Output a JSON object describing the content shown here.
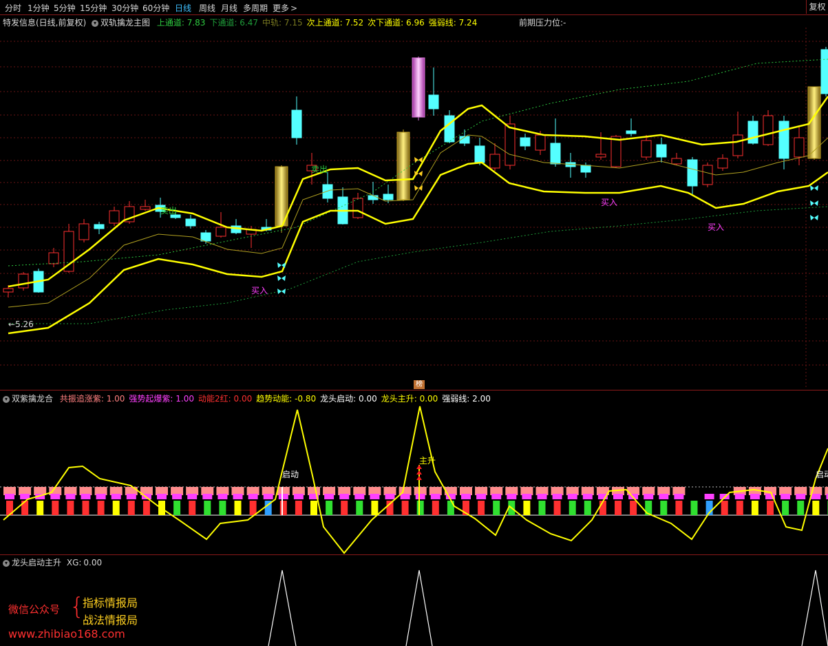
{
  "toolbar": {
    "periods": [
      "分时",
      "1分钟",
      "5分钟",
      "15分钟",
      "30分钟",
      "60分钟",
      "日线",
      "周线",
      "月线",
      "多周期",
      "更多"
    ],
    "active_period": "日线",
    "more_arrow": ">",
    "fuquan": "复权"
  },
  "main_panel": {
    "stock_label": "特发信息(日线,前复权)",
    "indicator_name": "双轨擒龙主图",
    "values": [
      {
        "label": "上通道:",
        "value": "7.83",
        "color": "#2ecc40"
      },
      {
        "label": "下通道:",
        "value": "6.47",
        "color": "#1f9e3a"
      },
      {
        "label": "中轨:",
        "value": "7.15",
        "color": "#7a7a20"
      },
      {
        "label": "次上通道:",
        "value": "7.52",
        "color": "#ffff00"
      },
      {
        "label": "次下通道:",
        "value": "6.96",
        "color": "#ffff00"
      },
      {
        "label": "强弱线:",
        "value": "7.24",
        "color": "#ffff00"
      }
    ],
    "pressure_label": "前期压力位:",
    "pressure_value": "-",
    "low_marker": "5.26",
    "signals": {
      "sell": "卖出",
      "buy": "买入"
    },
    "bottom_tag": "榜"
  },
  "sub_panel1": {
    "indicator_name": "双紫擒龙合",
    "values": [
      {
        "label": "共振追涨紫:",
        "value": "1.00",
        "color": "#ff8080"
      },
      {
        "label": "强势起爆紫:",
        "value": "1.00",
        "color": "#ff40ff"
      },
      {
        "label": "动能2红:",
        "value": "0.00",
        "color": "#ff3030"
      },
      {
        "label": "趋势动能:",
        "value": "-0.80",
        "color": "#ffff00"
      },
      {
        "label": "龙头启动:",
        "value": "0.00",
        "color": "#ffffff"
      },
      {
        "label": "龙头主升:",
        "value": "0.00",
        "color": "#ffff00"
      },
      {
        "label": "强弱线:",
        "value": "2.00",
        "color": "#ffffff"
      }
    ],
    "annotations": {
      "start": "启动",
      "main_rise": "主升"
    }
  },
  "sub_panel2": {
    "indicator_name": "龙头启动主升",
    "xg_label": "XG:",
    "xg_value": "0.00"
  },
  "watermark": {
    "wechat": "微信公众号",
    "brace": "{",
    "line1": "指标情报局",
    "line2": "战法情报局",
    "url": "www.zhibiao168.com"
  },
  "colors": {
    "up": "#ff3030",
    "down": "#54ffff",
    "channel": "#ffff00",
    "gold": "#e0c020",
    "grid": "#8b1a1a"
  }
}
